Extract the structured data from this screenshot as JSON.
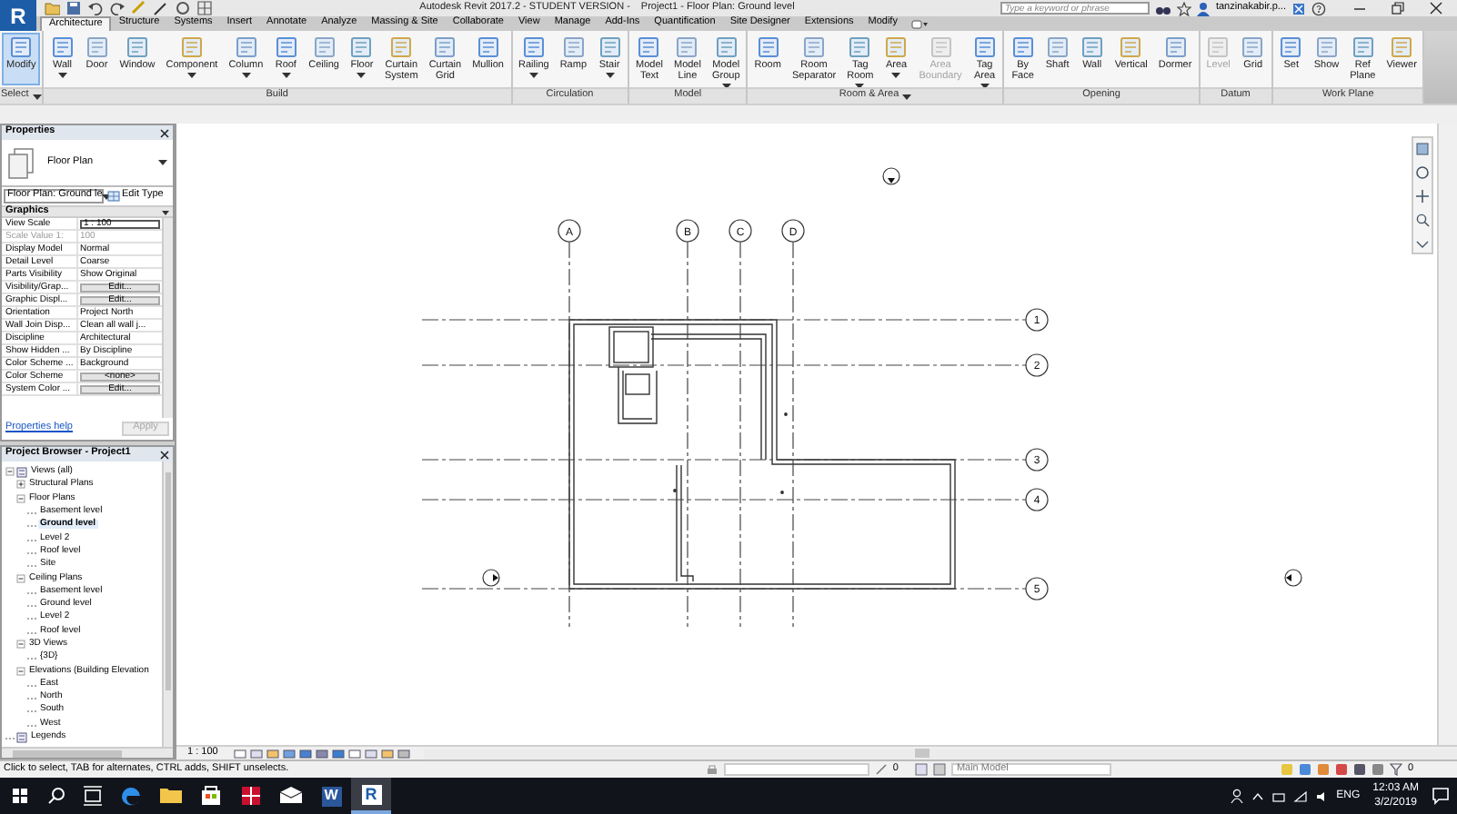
{
  "title_bar": {
    "logo": "R",
    "app_title": "Autodesk Revit 2017.2 - STUDENT VERSION -",
    "document_title": "Project1 - Floor Plan: Ground level",
    "search_placeholder": "Type a keyword or phrase",
    "user": "tanzinakabir.p..."
  },
  "tabs": [
    {
      "label": "Architecture",
      "selected": true
    },
    {
      "label": "Structure",
      "selected": false
    },
    {
      "label": "Systems",
      "selected": false
    },
    {
      "label": "Insert",
      "selected": false
    },
    {
      "label": "Annotate",
      "selected": false
    },
    {
      "label": "Analyze",
      "selected": false
    },
    {
      "label": "Massing & Site",
      "selected": false
    },
    {
      "label": "Collaborate",
      "selected": false
    },
    {
      "label": "View",
      "selected": false
    },
    {
      "label": "Manage",
      "selected": false
    },
    {
      "label": "Add-Ins",
      "selected": false
    },
    {
      "label": "Quantification",
      "selected": false
    },
    {
      "label": "Site Designer",
      "selected": false
    },
    {
      "label": "Extensions",
      "selected": false
    },
    {
      "label": "Modify",
      "selected": false
    }
  ],
  "ribbon_panels": [
    {
      "title": "Select",
      "menu": true,
      "tools": [
        {
          "label": "Modify",
          "dropdown": false,
          "selected": true,
          "disabled": false
        }
      ]
    },
    {
      "title": "Build",
      "tools": [
        {
          "label": "Wall",
          "dropdown": true,
          "selected": false,
          "disabled": false
        },
        {
          "label": "Door",
          "dropdown": false,
          "selected": false,
          "disabled": false
        },
        {
          "label": "Window",
          "dropdown": false,
          "selected": false,
          "disabled": false
        },
        {
          "label": "Component",
          "dropdown": true,
          "selected": false,
          "disabled": false
        },
        {
          "label": "Column",
          "dropdown": true,
          "selected": false,
          "disabled": false
        },
        {
          "label": "Roof",
          "dropdown": true,
          "selected": false,
          "disabled": false
        },
        {
          "label": "Ceiling",
          "dropdown": false,
          "selected": false,
          "disabled": false
        },
        {
          "label": "Floor",
          "dropdown": true,
          "selected": false,
          "disabled": false
        },
        {
          "label": "Curtain\nSystem",
          "dropdown": false,
          "selected": false,
          "disabled": false
        },
        {
          "label": "Curtain\nGrid",
          "dropdown": false,
          "selected": false,
          "disabled": false
        },
        {
          "label": "Mullion",
          "dropdown": false,
          "selected": false,
          "disabled": false
        }
      ]
    },
    {
      "title": "Circulation",
      "tools": [
        {
          "label": "Railing",
          "dropdown": true,
          "selected": false,
          "disabled": false
        },
        {
          "label": "Ramp",
          "dropdown": false,
          "selected": false,
          "disabled": false
        },
        {
          "label": "Stair",
          "dropdown": true,
          "selected": false,
          "disabled": false
        }
      ]
    },
    {
      "title": "Model",
      "tools": [
        {
          "label": "Model\nText",
          "dropdown": false,
          "selected": false,
          "disabled": false
        },
        {
          "label": "Model\nLine",
          "dropdown": false,
          "selected": false,
          "disabled": false
        },
        {
          "label": "Model\nGroup",
          "dropdown": true,
          "selected": false,
          "disabled": false
        }
      ]
    },
    {
      "title": "Room & Area",
      "menu": true,
      "tools": [
        {
          "label": "Room",
          "dropdown": false,
          "selected": false,
          "disabled": false
        },
        {
          "label": "Room\nSeparator",
          "dropdown": false,
          "selected": false,
          "disabled": false
        },
        {
          "label": "Tag\nRoom",
          "dropdown": true,
          "selected": false,
          "disabled": false
        },
        {
          "label": "Area",
          "dropdown": true,
          "selected": false,
          "disabled": false
        },
        {
          "label": "Area\nBoundary",
          "dropdown": false,
          "selected": false,
          "disabled": true
        },
        {
          "label": "Tag\nArea",
          "dropdown": true,
          "selected": false,
          "disabled": false
        }
      ]
    },
    {
      "title": "Opening",
      "tools": [
        {
          "label": "By\nFace",
          "dropdown": false,
          "selected": false,
          "disabled": false
        },
        {
          "label": "Shaft",
          "dropdown": false,
          "selected": false,
          "disabled": false
        },
        {
          "label": "Wall",
          "dropdown": false,
          "selected": false,
          "disabled": false
        },
        {
          "label": "Vertical",
          "dropdown": false,
          "selected": false,
          "disabled": false
        },
        {
          "label": "Dormer",
          "dropdown": false,
          "selected": false,
          "disabled": false
        }
      ]
    },
    {
      "title": "Datum",
      "tools": [
        {
          "label": "Level",
          "dropdown": false,
          "selected": false,
          "disabled": true
        },
        {
          "label": "Grid",
          "dropdown": false,
          "selected": false,
          "disabled": false
        }
      ]
    },
    {
      "title": "Work Plane",
      "tools": [
        {
          "label": "Set",
          "dropdown": false,
          "selected": false,
          "disabled": false
        },
        {
          "label": "Show",
          "dropdown": false,
          "selected": false,
          "disabled": false
        },
        {
          "label": "Ref\nPlane",
          "dropdown": false,
          "selected": false,
          "disabled": false
        },
        {
          "label": "Viewer",
          "dropdown": false,
          "selected": false,
          "disabled": false
        }
      ]
    }
  ],
  "properties": {
    "title": "Properties",
    "type_name": "Floor Plan",
    "instance": "Floor Plan: Ground le",
    "edit_type": "Edit Type",
    "group": "Graphics",
    "rows": [
      {
        "name": "View Scale",
        "value": "1 : 100",
        "kind": "field"
      },
      {
        "name": "Scale Value    1:",
        "value": "100",
        "kind": "readonly"
      },
      {
        "name": "Display Model",
        "value": "Normal",
        "kind": "text"
      },
      {
        "name": "Detail Level",
        "value": "Coarse",
        "kind": "text"
      },
      {
        "name": "Parts Visibility",
        "value": "Show Original",
        "kind": "text"
      },
      {
        "name": "Visibility/Grap...",
        "value": "Edit...",
        "kind": "button"
      },
      {
        "name": "Graphic Displ...",
        "value": "Edit...",
        "kind": "button"
      },
      {
        "name": "Orientation",
        "value": "Project North",
        "kind": "text"
      },
      {
        "name": "Wall Join Disp...",
        "value": "Clean all wall j...",
        "kind": "text"
      },
      {
        "name": "Discipline",
        "value": "Architectural",
        "kind": "text"
      },
      {
        "name": "Show Hidden ...",
        "value": "By Discipline",
        "kind": "text"
      },
      {
        "name": "Color Scheme ...",
        "value": "Background",
        "kind": "text"
      },
      {
        "name": "Color Scheme",
        "value": "<none>",
        "kind": "button"
      },
      {
        "name": "System Color ...",
        "value": "Edit...",
        "kind": "button"
      }
    ],
    "help": "Properties help",
    "apply": {
      "label": "Apply",
      "disabled": true
    }
  },
  "browser": {
    "title": "Project Browser - Project1",
    "tree": [
      {
        "label": "Views (all)",
        "expanded": true,
        "selected": false,
        "children": [
          {
            "label": "Structural Plans",
            "expanded": false,
            "selected": false
          },
          {
            "label": "Floor Plans",
            "expanded": true,
            "selected": false,
            "children": [
              {
                "label": "Basement level",
                "selected": false
              },
              {
                "label": "Ground level",
                "selected": true
              },
              {
                "label": "Level 2",
                "selected": false
              },
              {
                "label": "Roof level",
                "selected": false
              },
              {
                "label": "Site",
                "selected": false
              }
            ]
          },
          {
            "label": "Ceiling Plans",
            "expanded": true,
            "selected": false,
            "children": [
              {
                "label": "Basement level",
                "selected": false
              },
              {
                "label": "Ground level",
                "selected": false
              },
              {
                "label": "Level 2",
                "selected": false
              },
              {
                "label": "Roof level",
                "selected": false
              }
            ]
          },
          {
            "label": "3D Views",
            "expanded": true,
            "selected": false,
            "children": [
              {
                "label": "{3D}",
                "selected": false
              }
            ]
          },
          {
            "label": "Elevations (Building Elevation",
            "expanded": true,
            "selected": false,
            "children": [
              {
                "label": "East",
                "selected": false
              },
              {
                "label": "North",
                "selected": false
              },
              {
                "label": "South",
                "selected": false
              },
              {
                "label": "West",
                "selected": false
              }
            ]
          }
        ]
      },
      {
        "label": "Legends",
        "selected": false
      }
    ]
  },
  "canvas": {
    "vertical_grids": [
      "A",
      "B",
      "C",
      "D"
    ],
    "horizontal_grids": [
      "1",
      "2",
      "3",
      "4",
      "5"
    ]
  },
  "view_control": {
    "scale": "1 : 100"
  },
  "status_bar": {
    "message": "Click to select, TAB for alternates, CTRL adds, SHIFT unselects.",
    "editable_count": "0",
    "model": "Main Model",
    "filter_count": "0"
  },
  "taskbar": {
    "apps": [
      {
        "kind": "edge",
        "active": false
      },
      {
        "kind": "explorer",
        "active": false
      },
      {
        "kind": "store",
        "active": false
      },
      {
        "kind": "gift",
        "active": false
      },
      {
        "kind": "mail",
        "active": false
      },
      {
        "kind": "word",
        "glyph": "W",
        "active": false
      },
      {
        "kind": "revit",
        "glyph": "R",
        "active": true
      }
    ],
    "language": "ENG",
    "time": "12:03 AM",
    "date": "3/2/2019"
  }
}
